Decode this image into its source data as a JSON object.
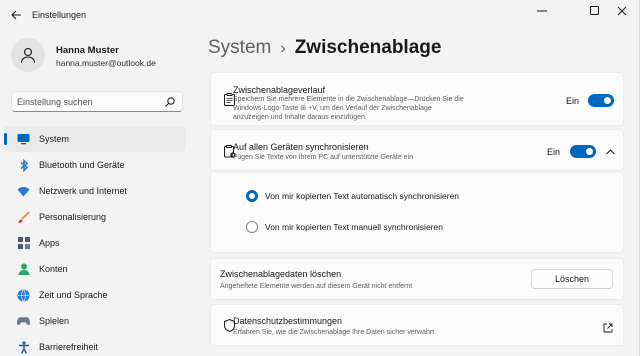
{
  "window": {
    "title": "Einstellungen",
    "controls": [
      "minimize-icon",
      "maximize-icon",
      "close-icon"
    ]
  },
  "profile": {
    "name": "Hanna Muster",
    "email": "hanna.muster@outlook.de"
  },
  "search": {
    "placeholder": "Einstellung suchen"
  },
  "sidebar": {
    "items": [
      {
        "label": "System",
        "icon": "monitor-icon",
        "active": true
      },
      {
        "label": "Bluetooth und Geräte",
        "icon": "bluetooth-icon"
      },
      {
        "label": "Netzwerk und Internet",
        "icon": "wifi-icon"
      },
      {
        "label": "Personalisierung",
        "icon": "brush-icon"
      },
      {
        "label": "Apps",
        "icon": "apps-icon"
      },
      {
        "label": "Konten",
        "icon": "person-icon"
      },
      {
        "label": "Zeit und Sprache",
        "icon": "globe-clock-icon"
      },
      {
        "label": "Spielen",
        "icon": "gamepad-icon"
      },
      {
        "label": "Barrierefreiheit",
        "icon": "accessibility-icon"
      }
    ]
  },
  "breadcrumb": {
    "parent": "System",
    "separator": "›",
    "current": "Zwischenablage"
  },
  "clipboard_history": {
    "title": "Zwischenablageverlauf",
    "description_line1": "Speichern Sie mehrere Elemente in die Zwischenablage—Drücken Sie die",
    "description_line2": "Windows-Logo-Taste ⊞ +V, um den Verlauf der Zwischenablage",
    "description_line3": "anzuzeigen und Inhalte daraus einzufügen.",
    "toggle_label": "Ein",
    "toggle_on": true
  },
  "sync": {
    "title": "Auf allen Geräten synchronisieren",
    "description": "Fügen Sie Texte von Ihrem PC auf unterstützte Geräte ein",
    "toggle_label": "Ein",
    "toggle_on": true,
    "options": [
      {
        "label": "Von mir kopierten Text automatisch synchronisieren",
        "selected": true
      },
      {
        "label": "Von mir kopierten Text manuell synchronisieren",
        "selected": false
      }
    ]
  },
  "clear_data": {
    "title": "Zwischenablagedaten löschen",
    "description": "Angeheftete Elemente werden auf diesem Gerät nicht entfernt",
    "button_label": "Löschen"
  },
  "privacy": {
    "title": "Datenschutzbestimmungen",
    "description": "Erfahren Sie, wie die Zwischenablage Ihre Daten sicher verwahrt"
  },
  "colors": {
    "accent": "#0067c0",
    "background": "#f3f3f3",
    "card": "#fbfbfb"
  }
}
